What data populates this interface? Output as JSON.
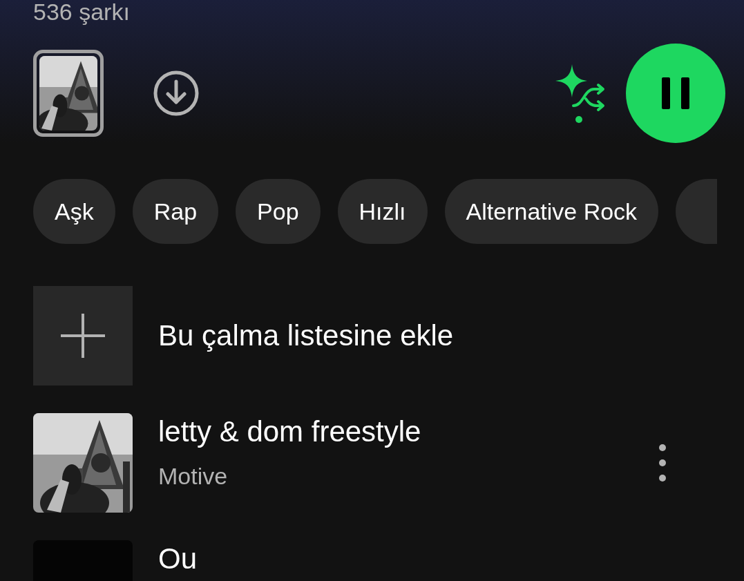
{
  "header": {
    "song_count": "536 şarkı"
  },
  "player": {
    "playing": true,
    "smart_shuffle_on": true
  },
  "filters": [
    {
      "label": "Aşk",
      "selected": false
    },
    {
      "label": "Rap",
      "selected": false
    },
    {
      "label": "Pop",
      "selected": false
    },
    {
      "label": "Hızlı",
      "selected": false
    },
    {
      "label": "Alternative Rock",
      "selected": false
    }
  ],
  "add_row": {
    "label": "Bu çalma listesine ekle"
  },
  "tracks": [
    {
      "title": "letty & dom freestyle",
      "artist": "Motive"
    },
    {
      "title": "Ou"
    }
  ]
}
